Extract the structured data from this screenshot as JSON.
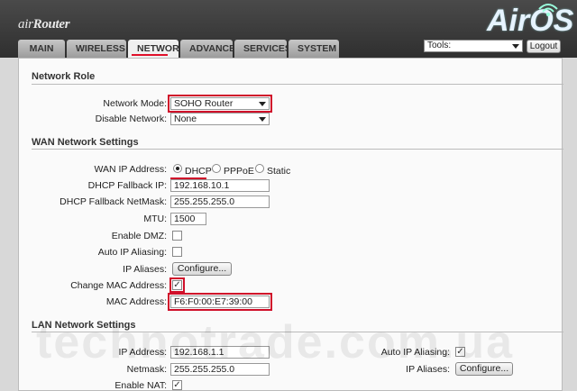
{
  "brand": {
    "left_logo": "airRouter",
    "left_logo_air": "air",
    "left_logo_router": "Router",
    "right_logo": "AirOS"
  },
  "tabs": [
    "MAIN",
    "WIRELESS",
    "NETWORK",
    "ADVANCED",
    "SERVICES",
    "SYSTEM"
  ],
  "active_tab": "NETWORK",
  "toolbar": {
    "tools_value": "Tools:",
    "logout_label": "Logout"
  },
  "network_role": {
    "title": "Network Role",
    "network_mode_label": "Network Mode:",
    "network_mode_value": "SOHO Router",
    "disable_network_label": "Disable Network:",
    "disable_network_value": "None"
  },
  "wan": {
    "title": "WAN Network Settings",
    "ip_address_label": "WAN IP Address:",
    "options": [
      "DHCP",
      "PPPoE",
      "Static"
    ],
    "selected_option": "DHCP",
    "dhcp_fallback_ip_label": "DHCP Fallback IP:",
    "dhcp_fallback_ip_value": "192.168.10.1",
    "dhcp_fallback_netmask_label": "DHCP Fallback NetMask:",
    "dhcp_fallback_netmask_value": "255.255.255.0",
    "mtu_label": "MTU:",
    "mtu_value": "1500",
    "enable_dmz_label": "Enable DMZ:",
    "enable_dmz_checked": false,
    "auto_ip_aliasing_label": "Auto IP Aliasing:",
    "auto_ip_aliasing_checked": false,
    "ip_aliases_label": "IP Aliases:",
    "configure_label": "Configure...",
    "change_mac_label": "Change MAC Address:",
    "change_mac_checked": true,
    "mac_address_label": "MAC Address:",
    "mac_address_value": "F6:F0:00:E7:39:00"
  },
  "lan": {
    "title": "LAN Network Settings",
    "ip_address_label": "IP Address:",
    "ip_address_value": "192.168.1.1",
    "netmask_label": "Netmask:",
    "netmask_value": "255.255.255.0",
    "enable_nat_label": "Enable NAT:",
    "enable_nat_checked": true,
    "auto_ip_aliasing_label": "Auto IP Aliasing:",
    "auto_ip_aliasing_checked": true,
    "ip_aliases_label": "IP Aliases:",
    "configure_label": "Configure..."
  },
  "watermark": "technotrade.com.ua",
  "colors": {
    "highlight": "#d0102a",
    "header": "#3a3a3a",
    "panel": "#fafafa"
  }
}
